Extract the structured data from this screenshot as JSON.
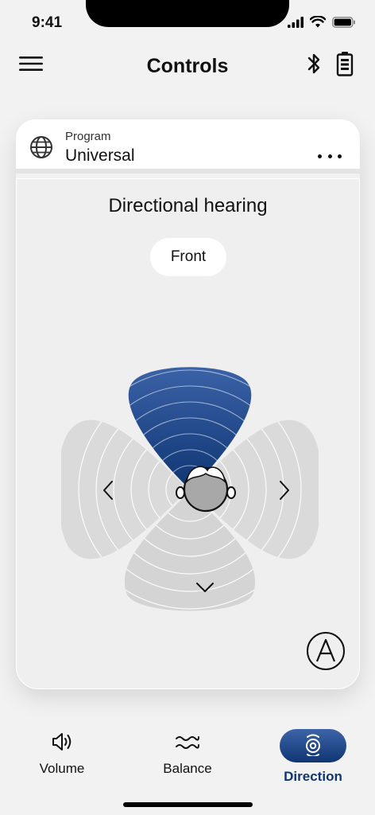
{
  "status_bar": {
    "time": "9:41"
  },
  "header": {
    "title": "Controls"
  },
  "program": {
    "label": "Program",
    "value": "Universal"
  },
  "directional": {
    "title": "Directional hearing",
    "selected_direction": "Front"
  },
  "nav": {
    "items": [
      {
        "label": "Volume",
        "active": false
      },
      {
        "label": "Balance",
        "active": false
      },
      {
        "label": "Direction",
        "active": true
      }
    ]
  },
  "colors": {
    "accent": "#0f3573",
    "beam_active": "#1c4a90",
    "beam_inactive": "#d8d8d8",
    "active_label": "#0f3573"
  },
  "icons": {
    "menu": "hamburger-menu-icon",
    "bluetooth": "bluetooth-icon",
    "battery": "battery-icon",
    "program": "globe-icon",
    "more": "more-horizontal-icon",
    "auto": "auto-mode-icon",
    "volume": "speaker-icon",
    "balance": "waves-icon",
    "direction": "direction-icon"
  }
}
